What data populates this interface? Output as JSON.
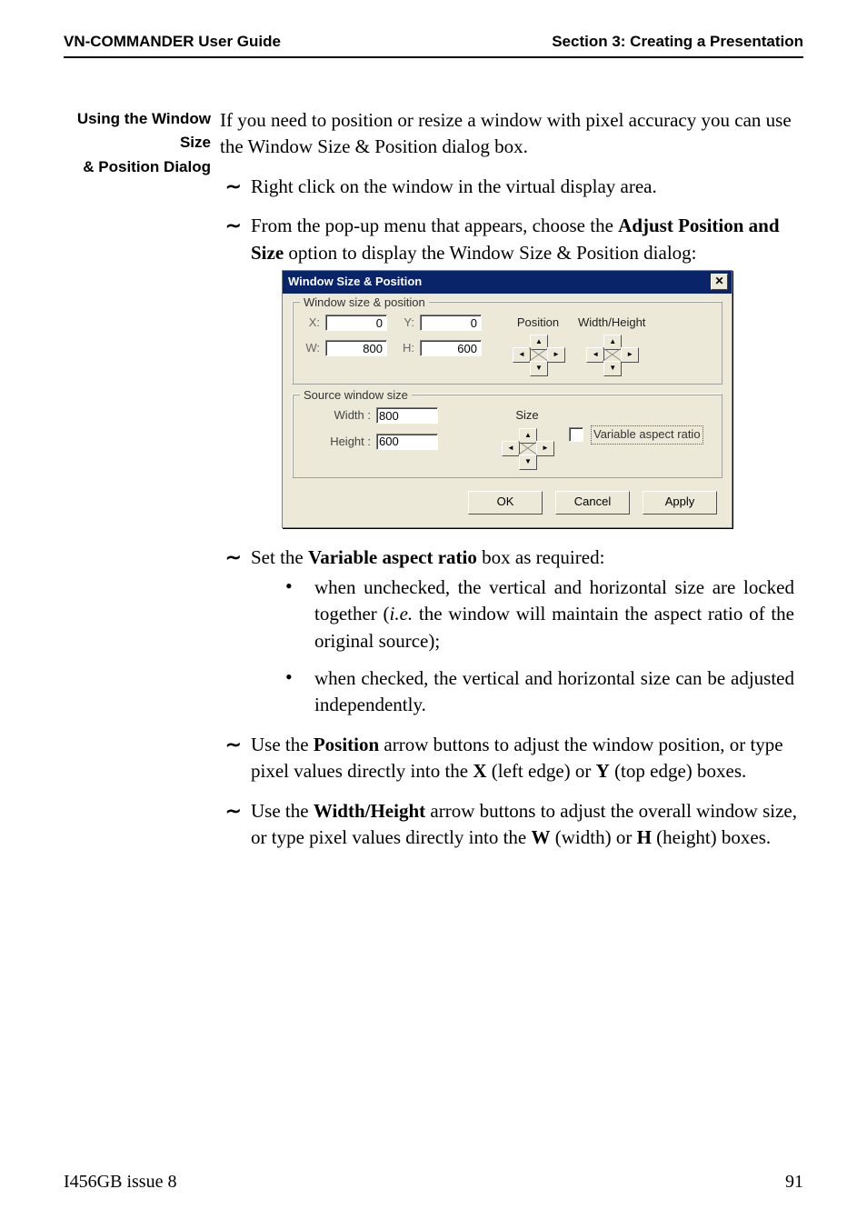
{
  "header": {
    "left": "VN-COMMANDER User Guide",
    "right": "Section 3: Creating a Presentation"
  },
  "margin_heading": {
    "line1": "Using the Window Size",
    "line2": "& Position Dialog"
  },
  "intro": "If you need to position or resize a window with pixel accuracy you can use the Window Size & Position dialog box.",
  "steps": {
    "s1": "Right click on the window in the virtual display area.",
    "s2a": "From the pop-up menu that appears, choose the ",
    "s2b_bold": "Adjust Position and Size",
    "s2c": " option to display the Window Size & Position dialog:",
    "s3a": "Set the ",
    "s3b_bold": "Variable aspect ratio",
    "s3c": " box as required:",
    "s3_b1a": "when unchecked, the vertical and horizontal size are locked together (",
    "s3_b1_ital": "i.e.",
    "s3_b1b": " the window will maintain the aspect ratio of the original source);",
    "s3_b2": "when checked, the vertical and horizontal size can be adjusted independently.",
    "s4a": "Use the ",
    "s4b_bold": "Position",
    "s4c": " arrow buttons to adjust the window position, or type pixel values directly into the ",
    "s4d_bold": "X",
    "s4e": " (left edge) or ",
    "s4f_bold": "Y",
    "s4g": " (top edge) boxes.",
    "s5a": "Use the ",
    "s5b_bold": "Width/Height",
    "s5c": " arrow buttons to adjust the overall window size, or type pixel values directly into the ",
    "s5d_bold": "W",
    "s5e": " (width) or ",
    "s5f_bold": "H",
    "s5g": " (height) boxes."
  },
  "dialog": {
    "title": "Window Size & Position",
    "close_glyph": "✕",
    "group1_legend": "Window size & position",
    "pos_caption": "Position",
    "wh_caption": "Width/Height",
    "x_label": "X:",
    "y_label": "Y:",
    "w_label": "W:",
    "h_label": "H:",
    "x_value": "0",
    "y_value": "0",
    "w_value": "800",
    "h_value": "600",
    "group2_legend": "Source window size",
    "size_caption": "Size",
    "width_label": "Width :",
    "height_label": "Height :",
    "width_value": "800",
    "height_value": "600",
    "var_aspect_label": "Variable aspect ratio",
    "ok": "OK",
    "cancel": "Cancel",
    "apply": "Apply",
    "arrow_up": "▲",
    "arrow_down": "▼",
    "arrow_left": "◄",
    "arrow_right": "►"
  },
  "footer": {
    "left": "I456GB issue 8",
    "right": "91"
  }
}
